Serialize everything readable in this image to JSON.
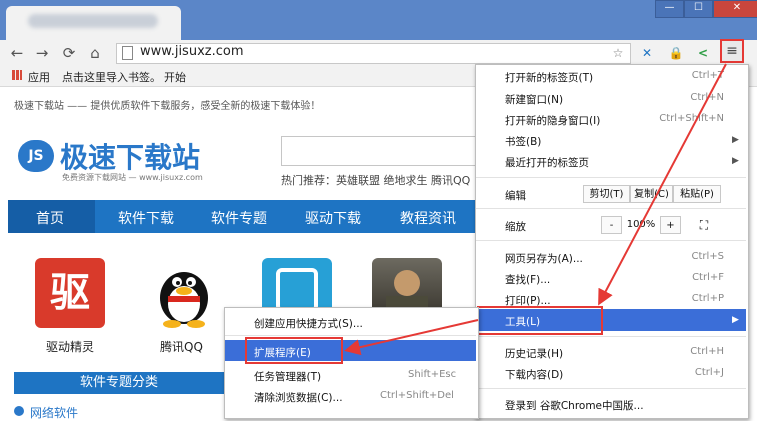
{
  "browser": {
    "window_controls": {
      "minimize": "—",
      "maximize": "☐",
      "close": "✕"
    },
    "nav": {
      "back": "←",
      "forward": "→",
      "reload": "⟳",
      "home": "⌂"
    },
    "url": "www.jisuxz.com",
    "menu_icon": "≡",
    "bookmarks": {
      "apps": "应用",
      "import": "点击这里导入书签。",
      "start": "开始"
    }
  },
  "page": {
    "slogan": "极速下载站 —— 提供优质软件下载服务，感受全新的极速下载体验！",
    "logo_badge": "JS",
    "logo_text": "极速下载站",
    "logo_sub": "免费资源下载网站 — www.jisuxz.com",
    "hot": "热门推荐：英雄联盟  绝地求生  腾讯QQ",
    "nav": [
      "首页",
      "软件下载",
      "软件专题",
      "驱动下载",
      "教程资讯"
    ],
    "apps": [
      {
        "label": "驱动精灵",
        "glyph": "驱"
      },
      {
        "label": "腾讯QQ",
        "glyph": ""
      }
    ],
    "category_head": "软件专题分类",
    "category_partial": "网络软件"
  },
  "chrome_menu": {
    "items": [
      {
        "label": "打开新的标签页(T)",
        "shortcut": "Ctrl+T"
      },
      {
        "label": "新建窗口(N)",
        "shortcut": "Ctrl+N"
      },
      {
        "label": "打开新的隐身窗口(I)",
        "shortcut": "Ctrl+Shift+N"
      },
      {
        "label": "书签(B)",
        "shortcut": ""
      },
      {
        "label": "最近打开的标签页",
        "shortcut": ""
      }
    ],
    "edit": {
      "label": "编辑",
      "cut": "剪切(T)",
      "copy": "复制(C)",
      "paste": "粘贴(P)"
    },
    "zoom": {
      "label": "缩放",
      "minus": "-",
      "value": "100%",
      "plus": "+",
      "fullscreen": "⛶"
    },
    "items2": [
      {
        "label": "网页另存为(A)...",
        "shortcut": "Ctrl+S"
      },
      {
        "label": "查找(F)...",
        "shortcut": "Ctrl+F"
      },
      {
        "label": "打印(P)...",
        "shortcut": "Ctrl+P"
      },
      {
        "label": "工具(L)",
        "shortcut": ""
      },
      {
        "label": "历史记录(H)",
        "shortcut": "Ctrl+H"
      },
      {
        "label": "下载内容(D)",
        "shortcut": "Ctrl+J"
      },
      {
        "label": "登录到 谷歌Chrome中国版...",
        "shortcut": ""
      }
    ]
  },
  "tools_submenu": {
    "items": [
      {
        "label": "创建应用快捷方式(S)...",
        "shortcut": ""
      },
      {
        "label": "扩展程序(E)",
        "shortcut": ""
      },
      {
        "label": "任务管理器(T)",
        "shortcut": "Shift+Esc"
      },
      {
        "label": "清除浏览数据(C)...",
        "shortcut": "Ctrl+Shift+Del"
      }
    ]
  },
  "colors": {
    "highlight": "#3b6ed8",
    "annotation": "#e53935",
    "brand": "#1e74c3"
  }
}
